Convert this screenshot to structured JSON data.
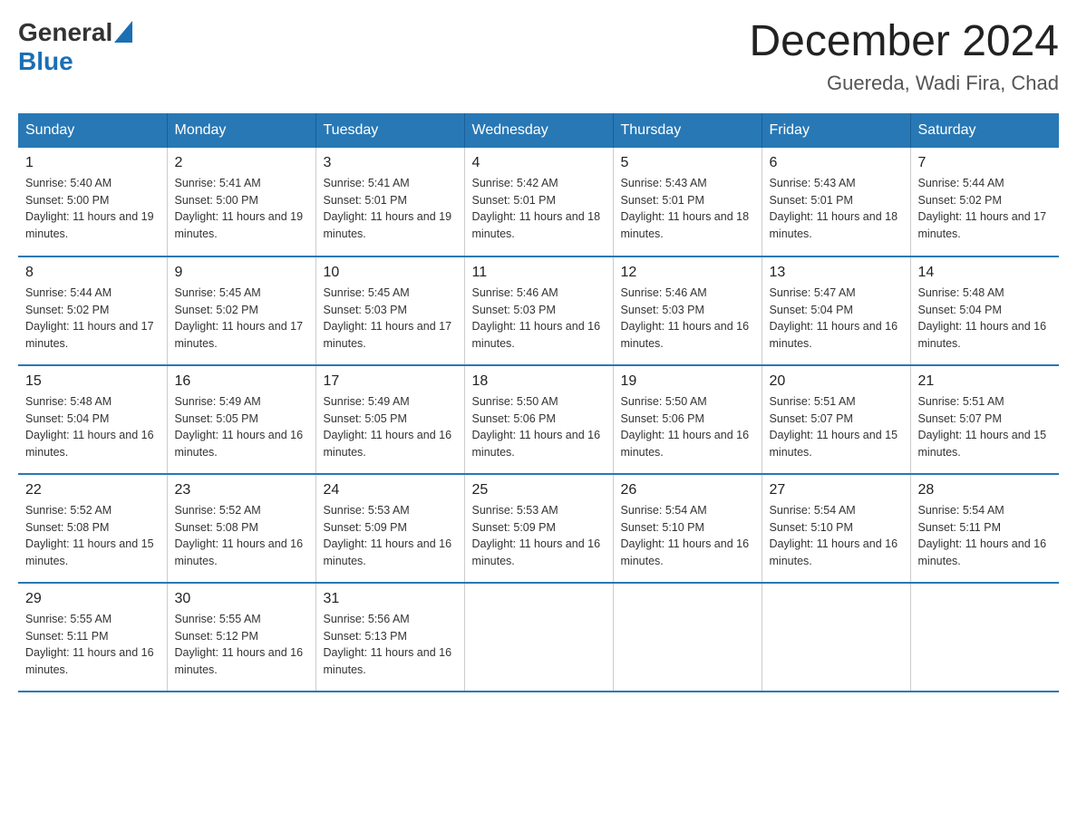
{
  "logo": {
    "general": "General",
    "triangle": "▲",
    "blue": "Blue"
  },
  "title": "December 2024",
  "location": "Guereda, Wadi Fira, Chad",
  "days_of_week": [
    "Sunday",
    "Monday",
    "Tuesday",
    "Wednesday",
    "Thursday",
    "Friday",
    "Saturday"
  ],
  "weeks": [
    [
      {
        "day": "1",
        "sunrise": "5:40 AM",
        "sunset": "5:00 PM",
        "daylight": "11 hours and 19 minutes."
      },
      {
        "day": "2",
        "sunrise": "5:41 AM",
        "sunset": "5:00 PM",
        "daylight": "11 hours and 19 minutes."
      },
      {
        "day": "3",
        "sunrise": "5:41 AM",
        "sunset": "5:01 PM",
        "daylight": "11 hours and 19 minutes."
      },
      {
        "day": "4",
        "sunrise": "5:42 AM",
        "sunset": "5:01 PM",
        "daylight": "11 hours and 18 minutes."
      },
      {
        "day": "5",
        "sunrise": "5:43 AM",
        "sunset": "5:01 PM",
        "daylight": "11 hours and 18 minutes."
      },
      {
        "day": "6",
        "sunrise": "5:43 AM",
        "sunset": "5:01 PM",
        "daylight": "11 hours and 18 minutes."
      },
      {
        "day": "7",
        "sunrise": "5:44 AM",
        "sunset": "5:02 PM",
        "daylight": "11 hours and 17 minutes."
      }
    ],
    [
      {
        "day": "8",
        "sunrise": "5:44 AM",
        "sunset": "5:02 PM",
        "daylight": "11 hours and 17 minutes."
      },
      {
        "day": "9",
        "sunrise": "5:45 AM",
        "sunset": "5:02 PM",
        "daylight": "11 hours and 17 minutes."
      },
      {
        "day": "10",
        "sunrise": "5:45 AM",
        "sunset": "5:03 PM",
        "daylight": "11 hours and 17 minutes."
      },
      {
        "day": "11",
        "sunrise": "5:46 AM",
        "sunset": "5:03 PM",
        "daylight": "11 hours and 16 minutes."
      },
      {
        "day": "12",
        "sunrise": "5:46 AM",
        "sunset": "5:03 PM",
        "daylight": "11 hours and 16 minutes."
      },
      {
        "day": "13",
        "sunrise": "5:47 AM",
        "sunset": "5:04 PM",
        "daylight": "11 hours and 16 minutes."
      },
      {
        "day": "14",
        "sunrise": "5:48 AM",
        "sunset": "5:04 PM",
        "daylight": "11 hours and 16 minutes."
      }
    ],
    [
      {
        "day": "15",
        "sunrise": "5:48 AM",
        "sunset": "5:04 PM",
        "daylight": "11 hours and 16 minutes."
      },
      {
        "day": "16",
        "sunrise": "5:49 AM",
        "sunset": "5:05 PM",
        "daylight": "11 hours and 16 minutes."
      },
      {
        "day": "17",
        "sunrise": "5:49 AM",
        "sunset": "5:05 PM",
        "daylight": "11 hours and 16 minutes."
      },
      {
        "day": "18",
        "sunrise": "5:50 AM",
        "sunset": "5:06 PM",
        "daylight": "11 hours and 16 minutes."
      },
      {
        "day": "19",
        "sunrise": "5:50 AM",
        "sunset": "5:06 PM",
        "daylight": "11 hours and 16 minutes."
      },
      {
        "day": "20",
        "sunrise": "5:51 AM",
        "sunset": "5:07 PM",
        "daylight": "11 hours and 15 minutes."
      },
      {
        "day": "21",
        "sunrise": "5:51 AM",
        "sunset": "5:07 PM",
        "daylight": "11 hours and 15 minutes."
      }
    ],
    [
      {
        "day": "22",
        "sunrise": "5:52 AM",
        "sunset": "5:08 PM",
        "daylight": "11 hours and 15 minutes."
      },
      {
        "day": "23",
        "sunrise": "5:52 AM",
        "sunset": "5:08 PM",
        "daylight": "11 hours and 16 minutes."
      },
      {
        "day": "24",
        "sunrise": "5:53 AM",
        "sunset": "5:09 PM",
        "daylight": "11 hours and 16 minutes."
      },
      {
        "day": "25",
        "sunrise": "5:53 AM",
        "sunset": "5:09 PM",
        "daylight": "11 hours and 16 minutes."
      },
      {
        "day": "26",
        "sunrise": "5:54 AM",
        "sunset": "5:10 PM",
        "daylight": "11 hours and 16 minutes."
      },
      {
        "day": "27",
        "sunrise": "5:54 AM",
        "sunset": "5:10 PM",
        "daylight": "11 hours and 16 minutes."
      },
      {
        "day": "28",
        "sunrise": "5:54 AM",
        "sunset": "5:11 PM",
        "daylight": "11 hours and 16 minutes."
      }
    ],
    [
      {
        "day": "29",
        "sunrise": "5:55 AM",
        "sunset": "5:11 PM",
        "daylight": "11 hours and 16 minutes."
      },
      {
        "day": "30",
        "sunrise": "5:55 AM",
        "sunset": "5:12 PM",
        "daylight": "11 hours and 16 minutes."
      },
      {
        "day": "31",
        "sunrise": "5:56 AM",
        "sunset": "5:13 PM",
        "daylight": "11 hours and 16 minutes."
      },
      null,
      null,
      null,
      null
    ]
  ]
}
